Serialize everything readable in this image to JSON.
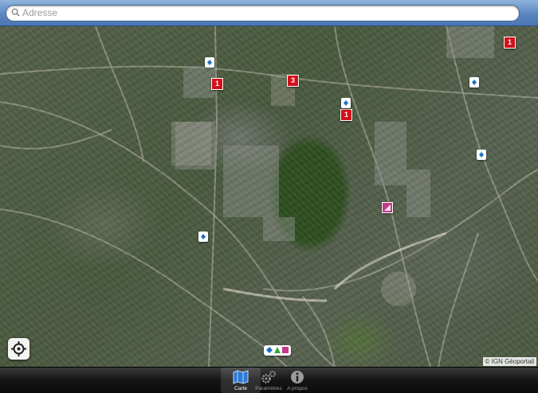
{
  "search": {
    "placeholder": "Adresse",
    "value": ""
  },
  "map": {
    "attribution": "© IGN Géoportail",
    "markers_red": [
      {
        "label": "1"
      },
      {
        "label": "3"
      },
      {
        "label": "1"
      },
      {
        "label": "1"
      }
    ]
  },
  "tabs": [
    {
      "label": "Carte",
      "icon": "map-icon",
      "active": true
    },
    {
      "label": "Paramètres",
      "icon": "gears-icon",
      "active": false
    },
    {
      "label": "A propos",
      "icon": "info-icon",
      "active": false
    }
  ],
  "colors": {
    "topbar": "#5b86c0",
    "red_marker": "#d40f1b",
    "blue_marker": "#1f6fc2",
    "pink_marker": "#c23a88"
  }
}
